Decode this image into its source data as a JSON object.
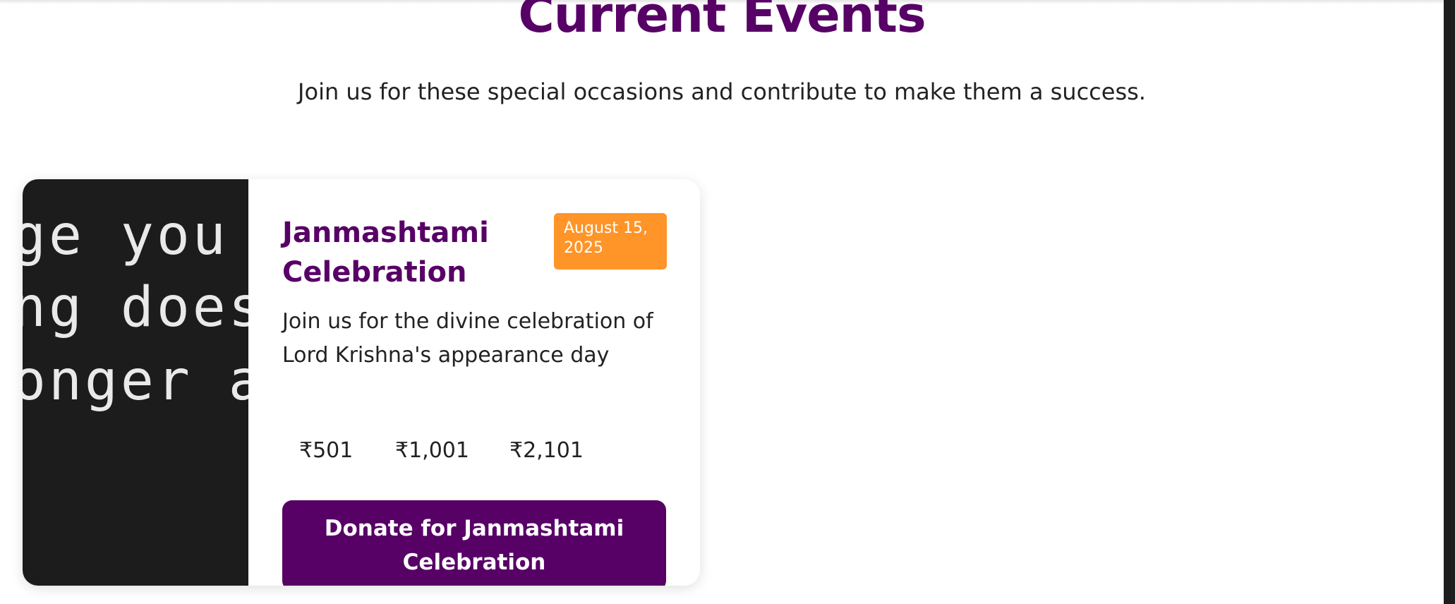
{
  "section": {
    "title": "Current Events",
    "subtitle": "Join us for these special occasions and contribute to make them a success."
  },
  "event": {
    "image_text_lines": [
      "ge you a",
      "ng does",
      "onger a"
    ],
    "title": "Janmashtami Celebration",
    "date": "August 15, 2025",
    "description": "Join us for the divine celebration of Lord Krishna's appearance day",
    "amounts": [
      "₹501",
      "₹1,001",
      "₹2,101"
    ],
    "donate_label": "Donate for Janmashtami Celebration"
  },
  "colors": {
    "brand_purple": "#570066",
    "badge_orange": "#ff9428",
    "image_background": "#1c1c1c"
  }
}
